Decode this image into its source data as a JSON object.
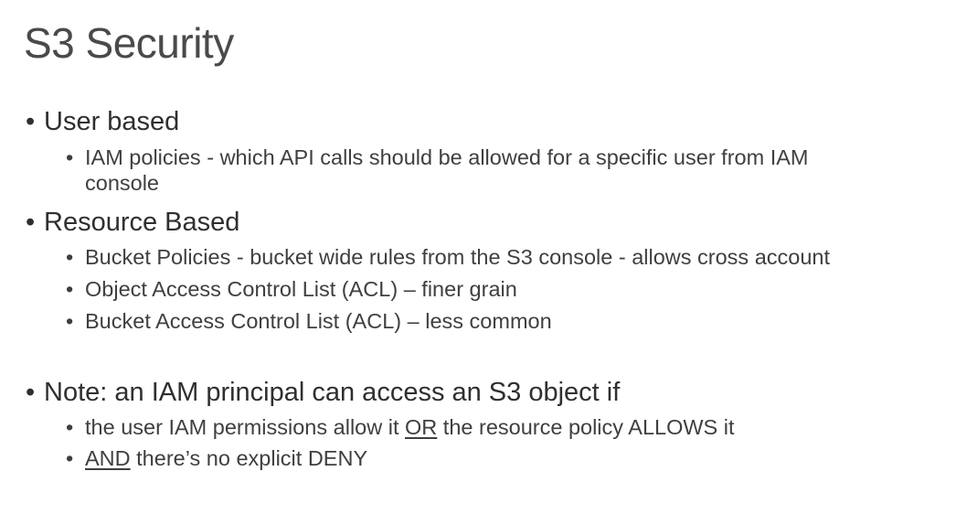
{
  "title": "S3 Security",
  "sections": {
    "user_based": {
      "heading": "User based",
      "items": [
        {
          "line1": "IAM policies - which API calls should be allowed for a specific user from IAM",
          "line2": "console"
        }
      ]
    },
    "resource_based": {
      "heading": "Resource Based",
      "items": [
        "Bucket Policies - bucket wide rules from the S3 console - allows cross account",
        "Object Access Control List (ACL) – finer grain",
        "Bucket Access Control List (ACL) – less common"
      ]
    },
    "note": {
      "label": "Note:",
      "text": " an IAM principal can access an S3 object if",
      "item1": {
        "before": "the user IAM permissions allow it ",
        "keyword": "OR",
        "after": " the resource policy ALLOWS it"
      },
      "item2": {
        "keyword": "AND",
        "after": " there’s no explicit DENY"
      }
    },
    "bullet": "•"
  }
}
